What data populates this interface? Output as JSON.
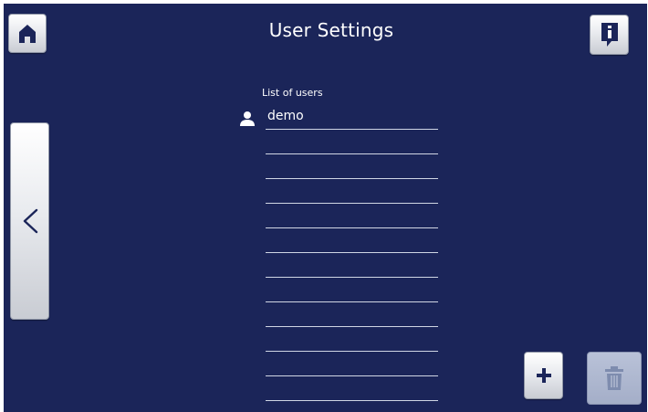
{
  "header": {
    "title": "User Settings"
  },
  "list": {
    "caption": "List of users",
    "rows": [
      {
        "name": "demo"
      },
      {
        "name": ""
      },
      {
        "name": ""
      },
      {
        "name": ""
      },
      {
        "name": ""
      },
      {
        "name": ""
      },
      {
        "name": ""
      },
      {
        "name": ""
      },
      {
        "name": ""
      },
      {
        "name": ""
      },
      {
        "name": ""
      },
      {
        "name": ""
      }
    ]
  },
  "buttons": {
    "home_icon": "home-icon",
    "info_icon": "info-icon",
    "back_label": "<",
    "add_label": "+",
    "delete_icon": "trash-icon",
    "delete_enabled": false
  },
  "colors": {
    "background": "#1b2559",
    "icon": "#1b2559",
    "text": "#ffffff"
  }
}
